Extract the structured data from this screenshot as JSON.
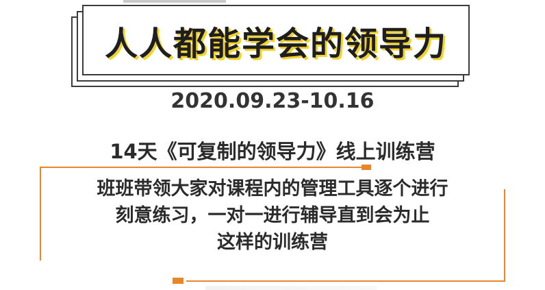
{
  "title": "人人都能学会的领导力",
  "date": "2020.09.23-10.16",
  "subtitle": "14天《可复制的领导力》线上训练营",
  "body": {
    "lines": [
      "班班带领大家对课程内的管理工具逐个进行",
      "刻意练习，一对一进行辅导直到会为止",
      "这样的训练营"
    ]
  },
  "colors": {
    "accent_orange": "#e8862a",
    "title_shadow_yellow": "#f2d22e",
    "text_dark": "#2a2a2a"
  }
}
